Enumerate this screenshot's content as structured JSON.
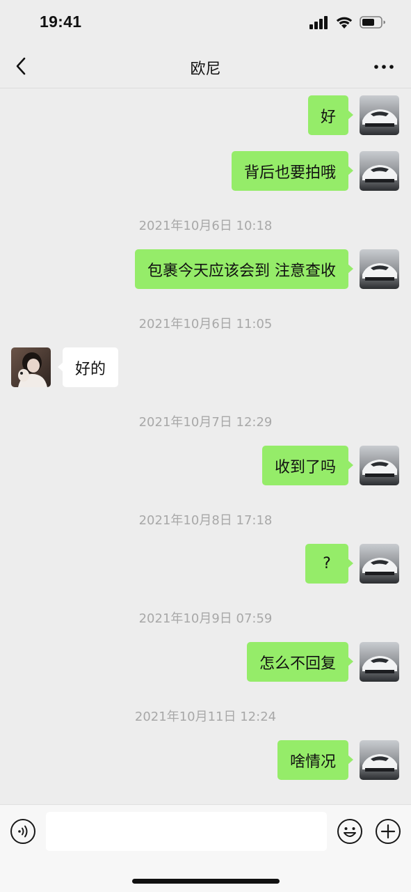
{
  "status_bar": {
    "time": "19:41"
  },
  "nav": {
    "title": "欧尼",
    "back_icon": "chevron-left-icon",
    "more_icon": "ellipsis-icon"
  },
  "messages": [
    {
      "type": "out",
      "text": "好"
    },
    {
      "type": "out",
      "text": "背后也要拍哦"
    },
    {
      "type": "time",
      "text": "2021年10月6日 10:18"
    },
    {
      "type": "out",
      "text": "包裹今天应该会到 注意查收"
    },
    {
      "type": "time",
      "text": "2021年10月6日 11:05"
    },
    {
      "type": "in",
      "text": "好的"
    },
    {
      "type": "time",
      "text": "2021年10月7日 12:29"
    },
    {
      "type": "out",
      "text": "收到了吗"
    },
    {
      "type": "time",
      "text": "2021年10月8日 17:18"
    },
    {
      "type": "out",
      "text": "?"
    },
    {
      "type": "time",
      "text": "2021年10月9日 07:59"
    },
    {
      "type": "out",
      "text": "怎么不回复"
    },
    {
      "type": "time",
      "text": "2021年10月11日 12:24"
    },
    {
      "type": "out",
      "text": "啥情况"
    }
  ],
  "input_bar": {
    "voice_icon": "voice-icon",
    "emoji_icon": "emoji-icon",
    "plus_icon": "plus-icon",
    "input_value": ""
  },
  "colors": {
    "background": "#ededed",
    "outgoing_bubble": "#95ec69",
    "incoming_bubble": "#ffffff",
    "timestamp": "#a8a8a8"
  }
}
